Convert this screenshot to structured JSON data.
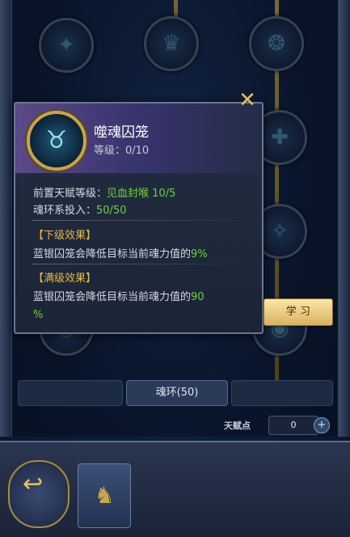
{
  "talent_tree": {
    "nodes": [
      {
        "label": "",
        "icon": "beast-icon"
      },
      {
        "label": "",
        "icon": "crown-icon"
      },
      {
        "label": "",
        "icon": "spirit-icon"
      },
      {
        "label": "",
        "icon": "plus-icon"
      },
      {
        "label": "",
        "icon": "cross-icon"
      },
      {
        "label": "",
        "icon": "orb-icon"
      },
      {
        "label": "",
        "icon": "orb-icon"
      }
    ]
  },
  "popup": {
    "title": "噬魂囚笼",
    "level": "等级：0/10",
    "icon": "soul-cage-icon",
    "prereq_label": "前置天赋等级：",
    "prereq_value": "见血封喉 10/5",
    "investment_label": "魂环系投入：",
    "investment_value": "50/50",
    "next_header": "【下级效果】",
    "next_text": "蓝银囚笼会降低目标当前魂力值的",
    "next_value": "9%",
    "max_header": "【满级效果】",
    "max_text": "蓝银囚笼会降低目标当前魂力值的",
    "max_value_a": "90",
    "max_value_b": "%",
    "close_icon": "close-icon",
    "learn_label": "学 习"
  },
  "tabs": [
    {
      "label": ""
    },
    {
      "label": "魂环(50)",
      "active": true
    },
    {
      "label": ""
    }
  ],
  "bottom": {
    "rules_label": "",
    "talent_points_label": "天赋点",
    "talent_points_value": "0",
    "plus_icon": "+"
  },
  "footer": {
    "back_label": "",
    "character_icon": "character-icon"
  },
  "colors": {
    "accent_gold": "#e4c05e",
    "effect_green": "#6fd23a",
    "section_orange": "#e7bb3e"
  }
}
